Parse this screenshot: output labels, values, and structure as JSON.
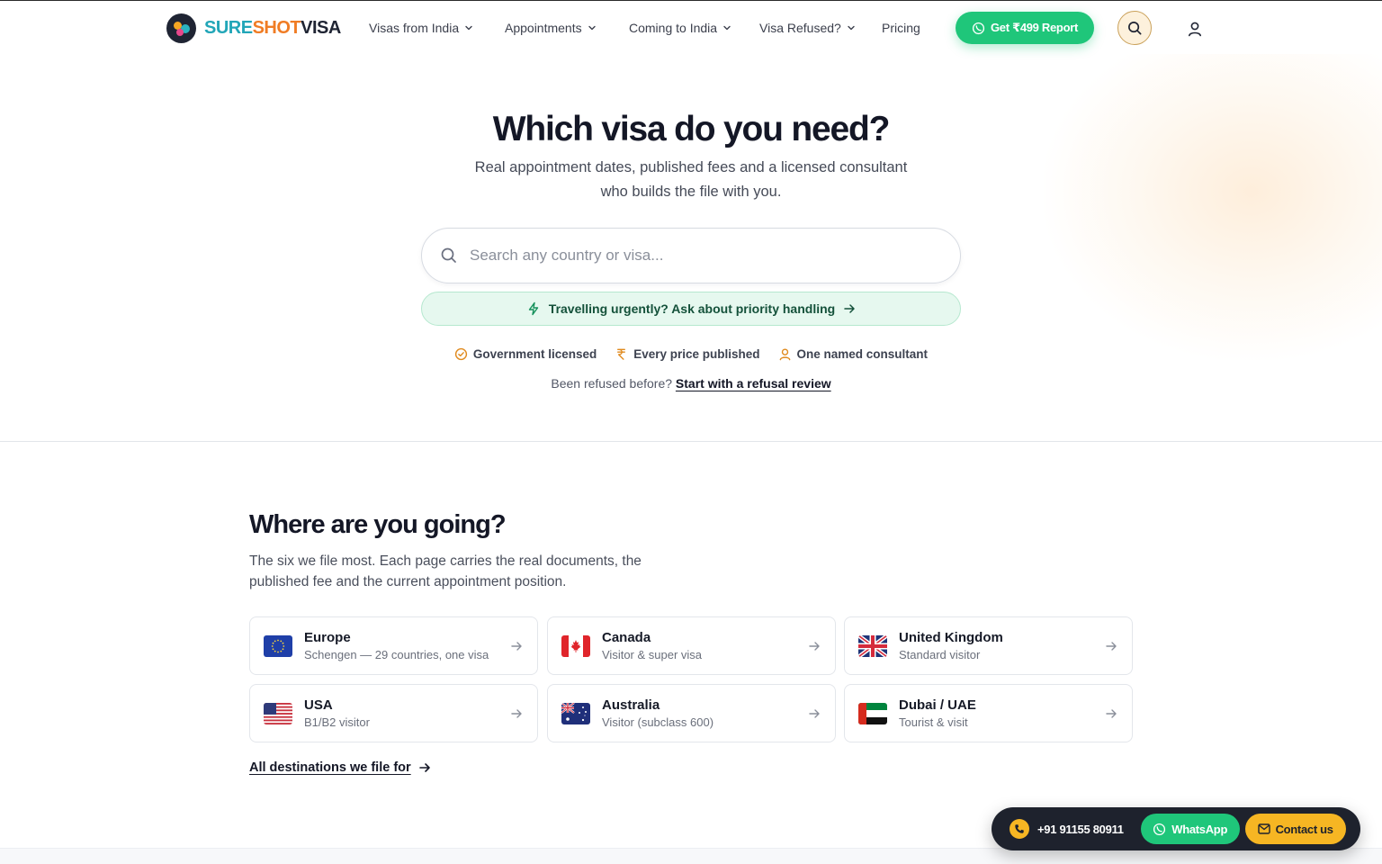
{
  "brand": {
    "part1": "SURE",
    "part2": "SHOT",
    "part3": "VISA",
    "colors": {
      "teal": "#22a6b8",
      "orange": "#f07c24",
      "dark": "#1f2433"
    }
  },
  "nav": {
    "items": [
      {
        "label": "Visas from India",
        "has_menu": true
      },
      {
        "label": "Appointments",
        "has_menu": true
      },
      {
        "label": "Coming to India",
        "has_menu": true
      },
      {
        "label": "Visa Refused?",
        "has_menu": true
      },
      {
        "label": "Pricing",
        "has_menu": false
      }
    ],
    "cta_label": "Get ₹499 Report",
    "search_icon": "search-icon",
    "user_icon": "user-icon"
  },
  "hero": {
    "title": "Which visa do you need?",
    "subtitle": "Real appointment dates, published fees and a licensed consultant who builds the file with you.",
    "search_placeholder": "Search any country or visa...",
    "urgent_label": "Travelling urgently? Ask about priority handling",
    "badges": [
      {
        "label": "Government licensed",
        "icon": "check-circle-icon"
      },
      {
        "label": "Every price published",
        "icon": "rupee-icon"
      },
      {
        "label": "One named consultant",
        "icon": "user-icon"
      }
    ],
    "refused_text": "Been refused before?",
    "refused_link": "Start with a refusal review"
  },
  "destinations": {
    "title": "Where are you going?",
    "subtitle": "The six we file most. Each page carries the real documents, the published fee and the current appointment position.",
    "cards": [
      {
        "name": "Europe",
        "desc": "Schengen — 29 countries, one visa",
        "flag": "eu-flag-icon"
      },
      {
        "name": "Canada",
        "desc": "Visitor & super visa",
        "flag": "canada-flag-icon"
      },
      {
        "name": "United Kingdom",
        "desc": "Standard visitor",
        "flag": "uk-flag-icon"
      },
      {
        "name": "USA",
        "desc": "B1/B2 visitor",
        "flag": "usa-flag-icon"
      },
      {
        "name": "Australia",
        "desc": "Visitor (subclass 600)",
        "flag": "australia-flag-icon"
      },
      {
        "name": "Dubai / UAE",
        "desc": "Tourist & visit",
        "flag": "uae-flag-icon"
      }
    ],
    "all_link": "All destinations we file for"
  },
  "contact_bar": {
    "phone": "+91 91155 80911",
    "whatsapp_label": "WhatsApp",
    "contact_label": "Contact us"
  },
  "colors": {
    "accent_green": "#1fc67a",
    "accent_yellow": "#f6b623",
    "urgent_bg": "#e6f8ef"
  }
}
